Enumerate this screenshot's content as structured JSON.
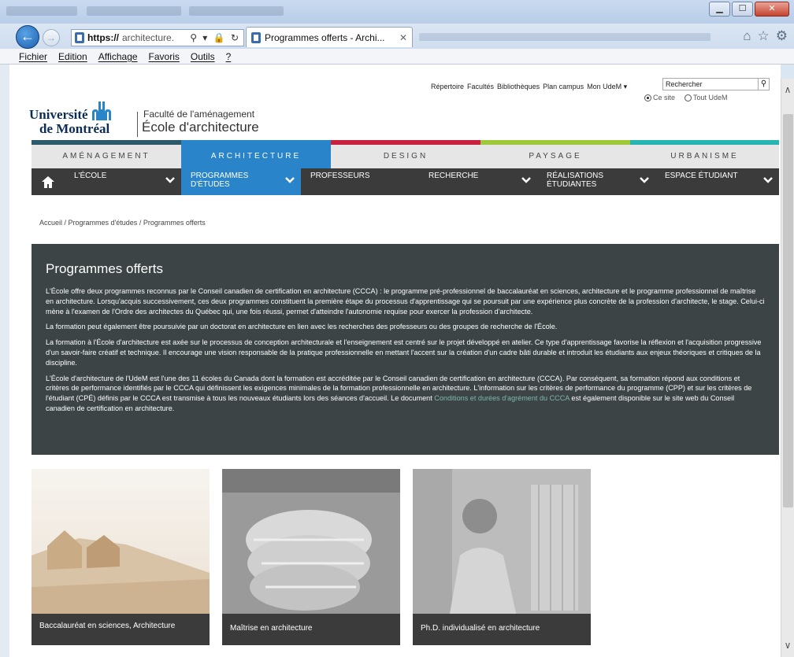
{
  "browser": {
    "address_https": "https://",
    "address_host": "architecture.",
    "address_controls": "⚲ ▾ 🔒 ↻",
    "tab_title": "Programmes offerts - Archi...",
    "tab_close": "✕",
    "window_buttons": {
      "minimize": "▁",
      "maximize": "☐",
      "close": "✕"
    },
    "menu": [
      "Fichier",
      "Edition",
      "Affichage",
      "Favoris",
      "Outils",
      "?"
    ]
  },
  "utility": {
    "links": [
      "Répertoire",
      "Facultés",
      "Bibliothèques",
      "Plan campus",
      "Mon UdeM ▾"
    ],
    "search_value": "Rechercher",
    "search_button": "⚲",
    "radio_site": "Ce site",
    "radio_all": "Tout UdeM"
  },
  "logo": {
    "university_line1": "Université",
    "university_line2": "de Montréal",
    "faculty": "Faculté de l'aménagement",
    "school": "École d'architecture"
  },
  "main_nav": {
    "items": [
      "AMÉNAGEMENT",
      "ARCHITECTURE",
      "DESIGN",
      "PAYSAGE",
      "URBANISME"
    ],
    "active": "ARCHITECTURE",
    "colors": [
      "#2d5a6b",
      "#2a84c9",
      "#c8203f",
      "#9fc83a",
      "#26b5b0"
    ]
  },
  "sub_nav": {
    "items": [
      {
        "label": "L'ÉCOLE",
        "dropdown": true
      },
      {
        "label": "PROGRAMMES D'ÉTUDES",
        "dropdown": true
      },
      {
        "label": "PROFESSEURS",
        "dropdown": false
      },
      {
        "label": "RECHERCHE",
        "dropdown": true
      },
      {
        "label": "RÉALISATIONS ÉTUDIANTES",
        "dropdown": true
      },
      {
        "label": "ESPACE ÉTUDIANT",
        "dropdown": true
      }
    ]
  },
  "breadcrumb": [
    "Accueil",
    "Programmes d'études",
    "Programmes offerts"
  ],
  "content": {
    "title": "Programmes offerts",
    "paragraphs": [
      "L'École offre deux programmes reconnus par le Conseil canadien de certification en architecture (CCCA) : le programme pré-professionnel de baccalauréat en sciences, architecture et le programme professionnel de maîtrise en architecture. Lorsqu'acquis successivement, ces deux programmes constituent la première étape du processus d'apprentissage qui se poursuit par une expérience plus concrète de la profession d'architecte, le stage. Celui-ci mène à l'examen de l'Ordre des architectes du Québec qui, une fois réussi, permet d'atteindre l'autonomie requise pour exercer la profession d'architecte.",
      "La formation peut également être poursuivie par un doctorat en architecture en lien avec les recherches des professeurs ou des groupes de recherche de l'École.",
      "La formation à l'École d'architecture est axée sur le processus de conception architecturale et l'enseignement est centré sur le projet développé en atelier. Ce type d'apprentissage favorise la réflexion et l'acquisition progressive d'un savoir-faire créatif et technique. Il encourage une vision responsable de la pratique professionnelle en mettant l'accent sur la création d'un cadre bâti durable et introduit les étudiants aux enjeux théoriques et critiques de la discipline."
    ],
    "last_paragraph_start": "L'École d'architecture de l'UdeM est l'une des 11 écoles du Canada dont la formation est accréditée par le Conseil canadien de certification en architecture (CCCA). Par conséquent, sa formation répond aux conditions et critères de performance identifiés par le CCCA qui définissent les exigences minimales de la formation professionnelle en architecture. L'information sur les critères de performance du programme (CPP) et sur les critères de l'étudiant (CPÉ) définis par le CCCA est transmise à tous les nouveaux étudiants lors des séances d'accueil. Le document ",
    "last_paragraph_link": "Conditions et durées d'agrément du CCCA",
    "last_paragraph_end": " est également disponible sur le site web du Conseil canadien de certification en architecture."
  },
  "cards": [
    {
      "caption": "Baccalauréat en sciences, Architecture"
    },
    {
      "caption": "Maîtrise en architecture"
    },
    {
      "caption": "Ph.D. individualisé en architecture"
    }
  ]
}
